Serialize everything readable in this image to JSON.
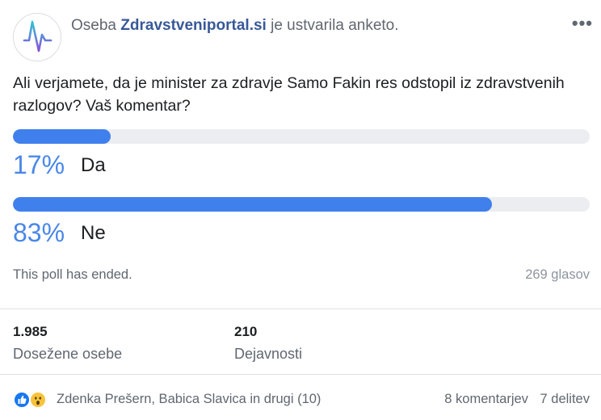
{
  "header": {
    "prefix": "Oseba",
    "page_name": "Zdravstveniportal.si",
    "suffix": "je ustvarila anketo.",
    "more_icon": "more-horizontal-icon"
  },
  "poll": {
    "question": "Ali verjamete, da je minister za zdravje Samo Fakin res odstopil iz zdravstvenih razlogov? Vaš komentar?",
    "options": [
      {
        "percent_label": "17%",
        "label": "Da",
        "fraction": 0.17
      },
      {
        "percent_label": "83%",
        "label": "Ne",
        "fraction": 0.83
      }
    ],
    "status": "This poll has ended.",
    "votes": "269 glasov",
    "accent_color": "#4080ec"
  },
  "stats": {
    "reach_value": "1.985",
    "reach_label": "Dosežene osebe",
    "engagement_value": "210",
    "engagement_label": "Dejavnosti"
  },
  "reactions": {
    "icons": [
      "like-icon",
      "wow-icon"
    ],
    "names": "Zdenka Prešern, Babica Slavica in drugi (10)",
    "comments": "8 komentarjev",
    "shares": "7 delitev"
  }
}
